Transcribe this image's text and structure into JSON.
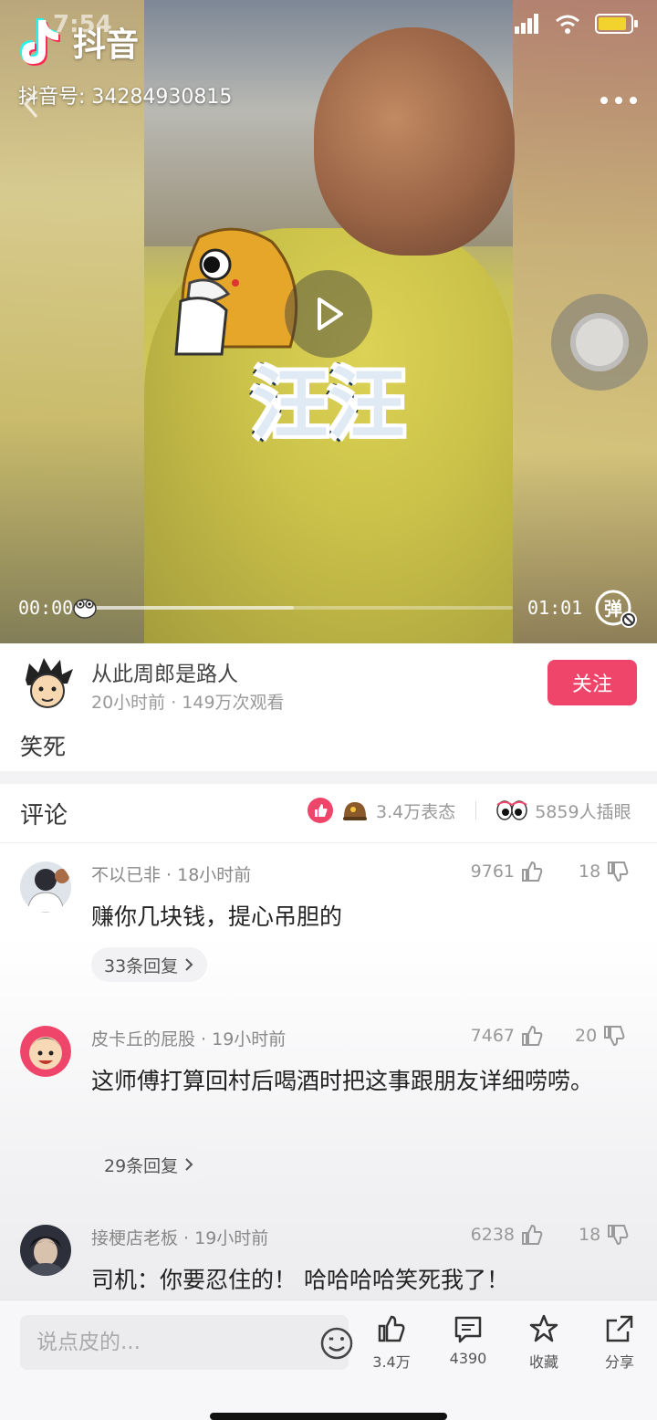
{
  "status_bar": {
    "time": "7:54"
  },
  "app": {
    "logo_text": "抖音",
    "account_id": "抖音号: 34284930815"
  },
  "video": {
    "sticker_text": "汪汪",
    "current_time": "00:00",
    "duration": "01:01",
    "progress_fraction": 0.48,
    "danmaku_label": "弹"
  },
  "author": {
    "name": "从此周郎是路人",
    "meta": "20小时前 · 149万次观看",
    "follow_label": "关注",
    "caption": "笑死"
  },
  "comments_section": {
    "title": "评论",
    "reactions_text": "3.4万表态",
    "eyes_text": "5859人插眼"
  },
  "comments": [
    {
      "user": "不以已非 · 18小时前",
      "likes": "9761",
      "dislikes": "18",
      "text": "赚你几块钱，提心吊胆的",
      "replies": "33条回复"
    },
    {
      "user": "皮卡丘的屁股 · 19小时前",
      "likes": "7467",
      "dislikes": "20",
      "text": "这师傅打算回村后喝酒时把这事跟朋友详细唠唠。",
      "replies": "29条回复"
    },
    {
      "user": "接梗店老板 · 19小时前",
      "likes": "6238",
      "dislikes": "18",
      "text": "司机：你要忍住的！ 哈哈哈哈笑死我了！",
      "replies": ""
    }
  ],
  "bottom_bar": {
    "input_placeholder": "说点皮的...",
    "like_count": "3.4万",
    "comment_count": "4390",
    "favorite_label": "收藏",
    "share_label": "分享"
  },
  "colors": {
    "accent": "#f0456a",
    "text_secondary": "#999999"
  }
}
